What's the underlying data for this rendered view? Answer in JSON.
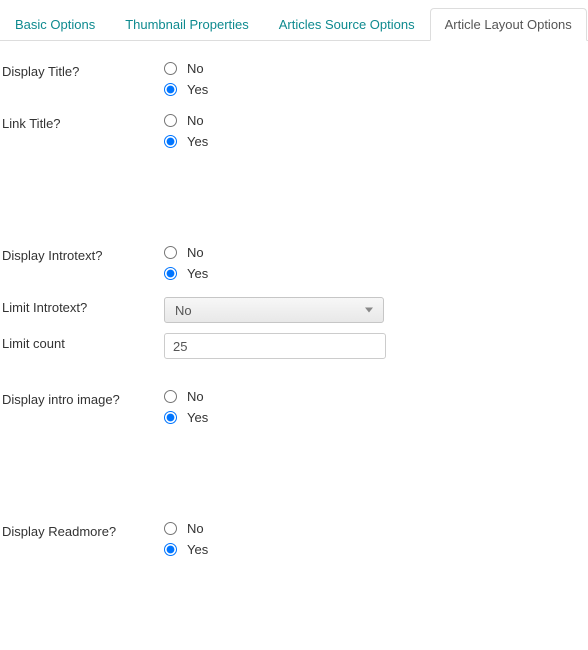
{
  "tabs": {
    "items": [
      {
        "label": "Basic Options"
      },
      {
        "label": "Thumbnail Properties"
      },
      {
        "label": "Articles Source Options"
      },
      {
        "label": "Article Layout Options"
      }
    ]
  },
  "options": {
    "no": "No",
    "yes": "Yes"
  },
  "fields": {
    "displayTitle": {
      "label": "Display Title?",
      "value": "yes"
    },
    "linkTitle": {
      "label": "Link Title?",
      "value": "yes"
    },
    "displayIntrotext": {
      "label": "Display Introtext?",
      "value": "yes"
    },
    "limitIntrotext": {
      "label": "Limit Introtext?",
      "value": "No"
    },
    "limitCount": {
      "label": "Limit count",
      "value": "25"
    },
    "displayIntroImage": {
      "label": "Display intro image?",
      "value": "yes"
    },
    "displayReadmore": {
      "label": "Display Readmore?",
      "value": "yes"
    }
  }
}
